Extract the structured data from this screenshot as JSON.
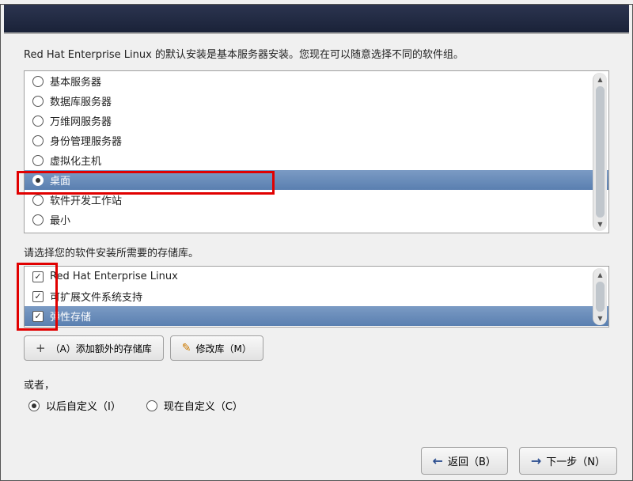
{
  "intro": "Red Hat Enterprise Linux 的默认安装是基本服务器安装。您现在可以随意选择不同的软件组。",
  "software_options": [
    {
      "label": "基本服务器",
      "selected": false
    },
    {
      "label": "数据库服务器",
      "selected": false
    },
    {
      "label": "万维网服务器",
      "selected": false
    },
    {
      "label": "身份管理服务器",
      "selected": false
    },
    {
      "label": "虚拟化主机",
      "selected": false
    },
    {
      "label": "桌面",
      "selected": true
    },
    {
      "label": "软件开发工作站",
      "selected": false
    },
    {
      "label": "最小",
      "selected": false
    }
  ],
  "repo_label": "请选择您的软件安装所需要的存储库。",
  "repos": [
    {
      "label": "Red Hat Enterprise Linux",
      "checked": true,
      "selected": false
    },
    {
      "label": "可扩展文件系统支持",
      "checked": true,
      "selected": false
    },
    {
      "label": "弹性存储",
      "checked": true,
      "selected": true
    }
  ],
  "buttons": {
    "add_repo": "（A）添加额外的存储库",
    "modify_repo": "修改库（M）"
  },
  "or_label": "或者，",
  "customize": {
    "later": "以后自定义（I）",
    "now": "现在自定义（C）",
    "selected": "later"
  },
  "nav": {
    "back": "返回（B）",
    "next": "下一步（N）"
  }
}
